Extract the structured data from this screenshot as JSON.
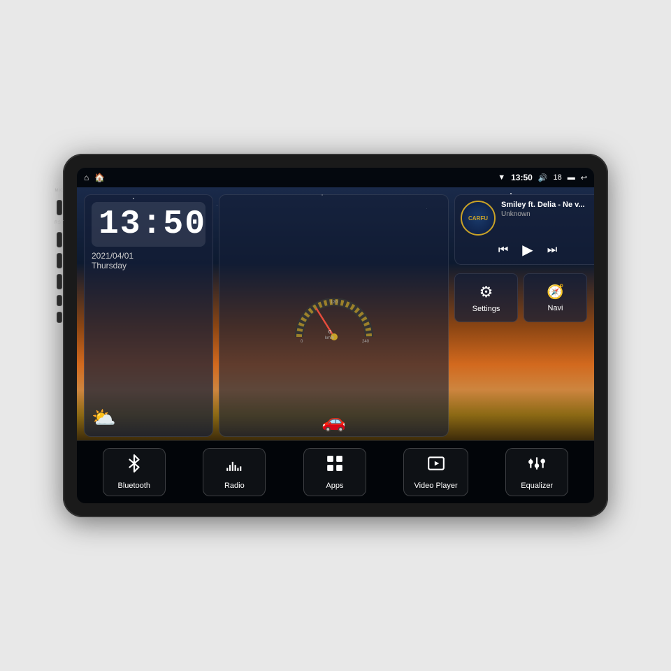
{
  "device": {
    "mic_label": "MIC",
    "rst_label": "RST"
  },
  "status_bar": {
    "home_icon": "⌂",
    "house_icon": "🏠",
    "wifi_icon": "▼",
    "time": "13:50",
    "volume_icon": "🔊",
    "volume_level": "18",
    "battery_icon": "▬",
    "back_icon": "↩"
  },
  "clock": {
    "time": "13:50",
    "date": "2021/04/01",
    "day": "Thursday"
  },
  "music": {
    "logo": "CARFU",
    "title": "Smiley ft. Delia - Ne v...",
    "artist": "Unknown",
    "prev_icon": "⏮",
    "play_icon": "▶",
    "next_icon": "⏭"
  },
  "settings_btn": {
    "label": "Settings",
    "icon": "⚙"
  },
  "navi_btn": {
    "label": "Navi",
    "icon": "▲"
  },
  "bottom_nav": [
    {
      "id": "bluetooth",
      "label": "Bluetooth",
      "icon": "bluetooth"
    },
    {
      "id": "radio",
      "label": "Radio",
      "icon": "radio"
    },
    {
      "id": "apps",
      "label": "Apps",
      "icon": "apps"
    },
    {
      "id": "video",
      "label": "Video Player",
      "icon": "video"
    },
    {
      "id": "equalizer",
      "label": "Equalizer",
      "icon": "equalizer"
    }
  ],
  "side_buttons": [
    {
      "id": "power",
      "label": "⏻"
    },
    {
      "id": "home",
      "label": "⌂"
    },
    {
      "id": "back",
      "label": "↩"
    },
    {
      "id": "vol_up",
      "label": "+"
    },
    {
      "id": "vol_down",
      "label": "-"
    }
  ]
}
